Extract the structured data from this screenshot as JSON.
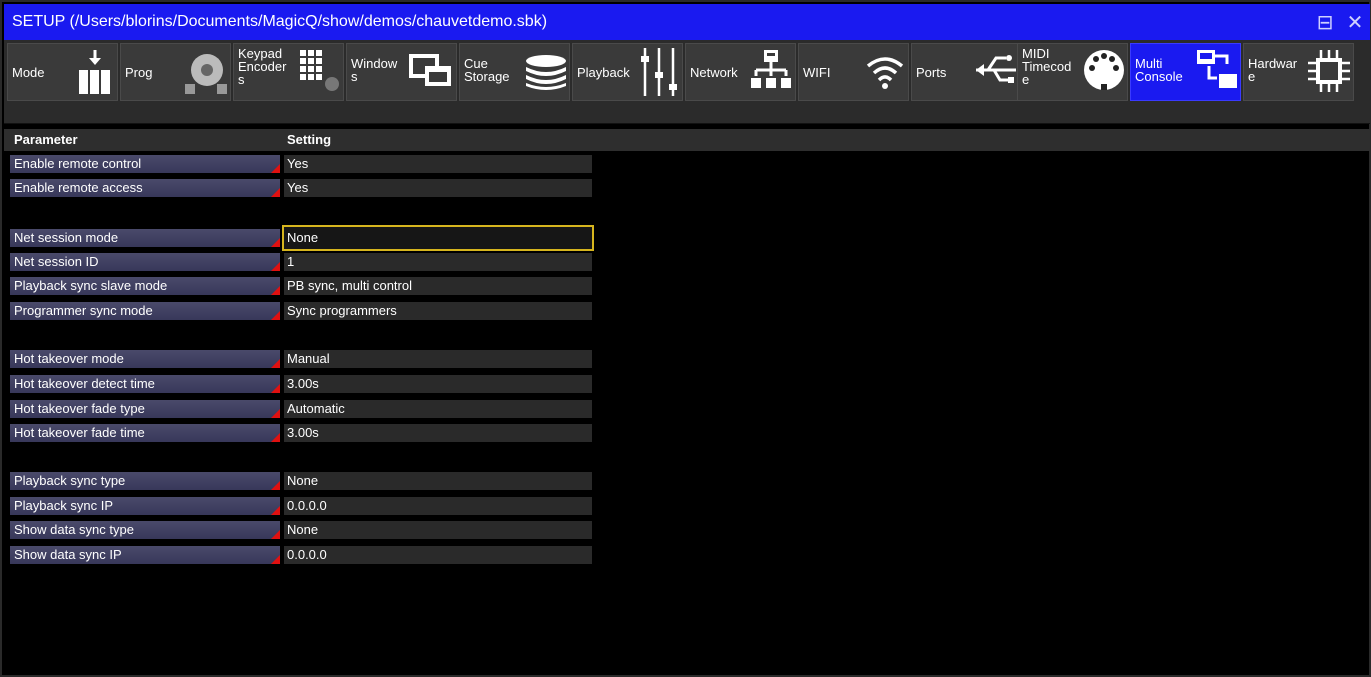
{
  "window": {
    "title": "SETUP (/Users/blorins/Documents/MagicQ/show/demos/chauvetdemo.sbk)",
    "restore_glyph": "⊟",
    "close_glyph": "✕"
  },
  "toolbar": {
    "active_index": 10,
    "items": [
      {
        "label": "Mode",
        "icon": "mode-icon"
      },
      {
        "label": "Prog",
        "icon": "prog-icon"
      },
      {
        "label": "Keypad\nEncoder\ns",
        "icon": "keypad-icon"
      },
      {
        "label": "Window\ns",
        "icon": "windows-icon"
      },
      {
        "label": "Cue\nStorage",
        "icon": "storage-icon"
      },
      {
        "label": "Playback",
        "icon": "playback-icon"
      },
      {
        "label": "Network",
        "icon": "network-icon"
      },
      {
        "label": "WIFI",
        "icon": "wifi-icon"
      },
      {
        "label": "Ports",
        "icon": "usb-icon"
      },
      {
        "label": "MIDI\nTimecod\ne",
        "icon": "midi-icon"
      },
      {
        "label": "Multi\nConsole",
        "icon": "multi-console-icon"
      },
      {
        "label": "Hardwar\ne",
        "icon": "chip-icon"
      }
    ]
  },
  "grid": {
    "header_parameter": "Parameter",
    "header_setting": "Setting",
    "rows": [
      {
        "param": "Enable remote control",
        "value": "Yes"
      },
      {
        "param": "Enable remote access",
        "value": "Yes"
      },
      {
        "param": "Net session mode",
        "value": "None"
      },
      {
        "param": "Net session ID",
        "value": "1"
      },
      {
        "param": "Playback sync slave mode",
        "value": "PB sync, multi control"
      },
      {
        "param": "Programmer sync mode",
        "value": "Sync programmers"
      },
      {
        "param": "Hot takeover mode",
        "value": "Manual"
      },
      {
        "param": "Hot takeover detect time",
        "value": "3.00s"
      },
      {
        "param": "Hot takeover fade type",
        "value": "Automatic"
      },
      {
        "param": "Hot takeover fade time",
        "value": "3.00s"
      },
      {
        "param": "Playback sync type",
        "value": "None"
      },
      {
        "param": "Playback sync IP",
        "value": "0.0.0.0"
      },
      {
        "param": "Show data sync type",
        "value": "None"
      },
      {
        "param": "Show data sync IP",
        "value": "0.0.0.0"
      }
    ]
  },
  "colors": {
    "title_bar": "#1a1af0",
    "active_tab": "#1a1af0",
    "selection_outline": "#d6b51e",
    "param_marker": "#e01010"
  }
}
